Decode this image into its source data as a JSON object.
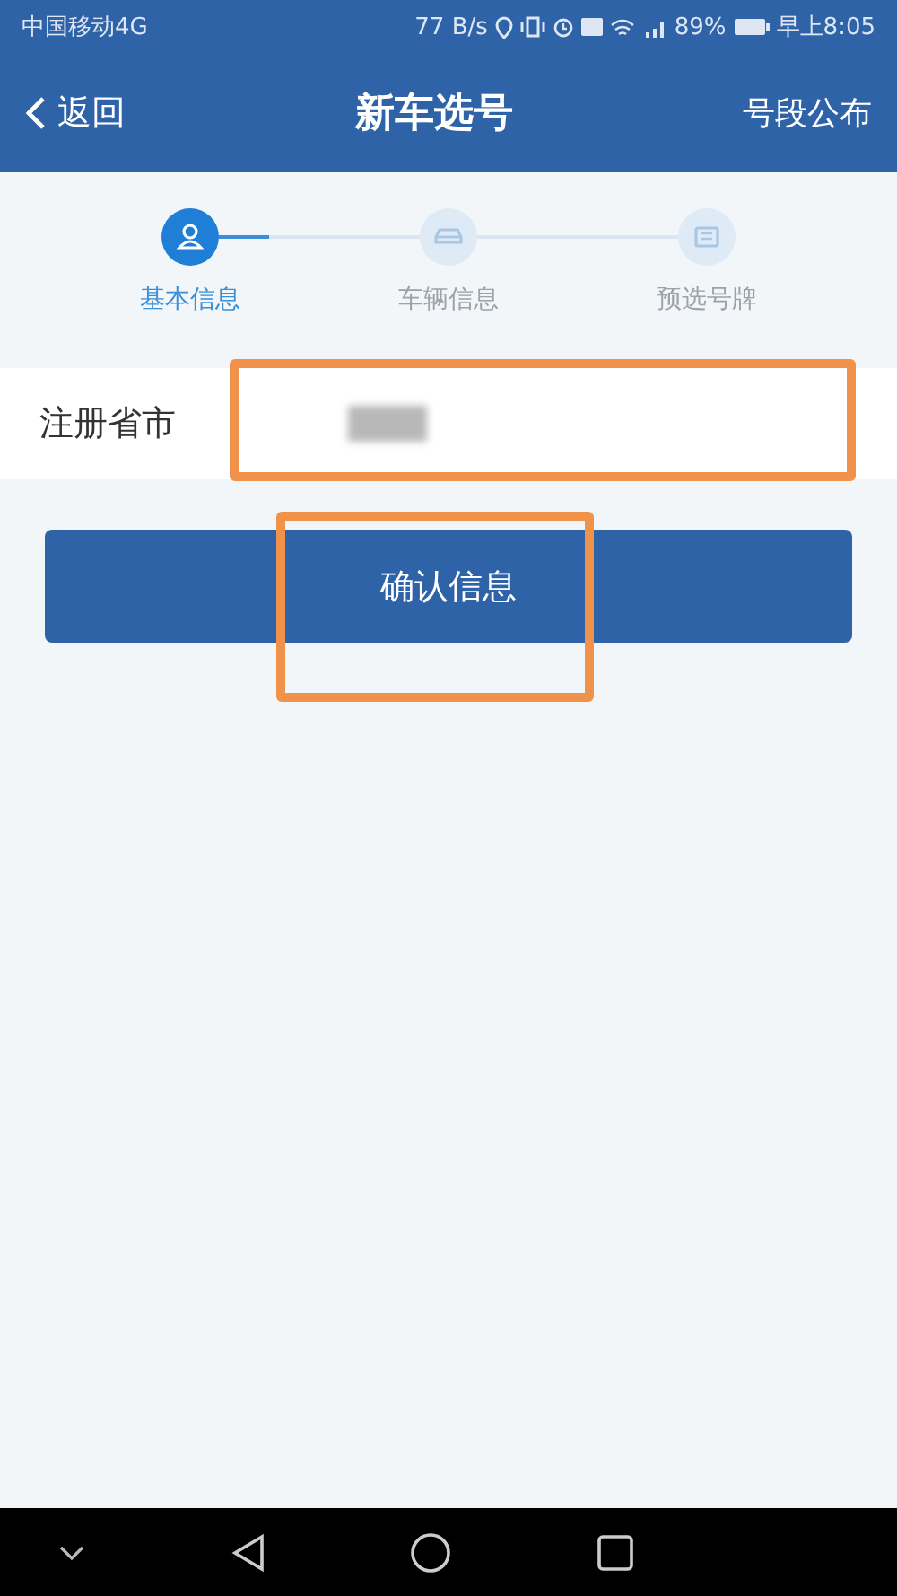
{
  "status_bar": {
    "carrier": "中国移动4G",
    "speed": "77 B/s",
    "battery": "89%",
    "time": "早上8:05"
  },
  "header": {
    "back": "返回",
    "title": "新车选号",
    "action": "号段公布"
  },
  "steps": [
    {
      "label": "基本信息",
      "selected": true
    },
    {
      "label": "车辆信息",
      "selected": false
    },
    {
      "label": "预选号牌",
      "selected": false
    }
  ],
  "form": {
    "label": "注册省市"
  },
  "confirm_button": "确认信息"
}
